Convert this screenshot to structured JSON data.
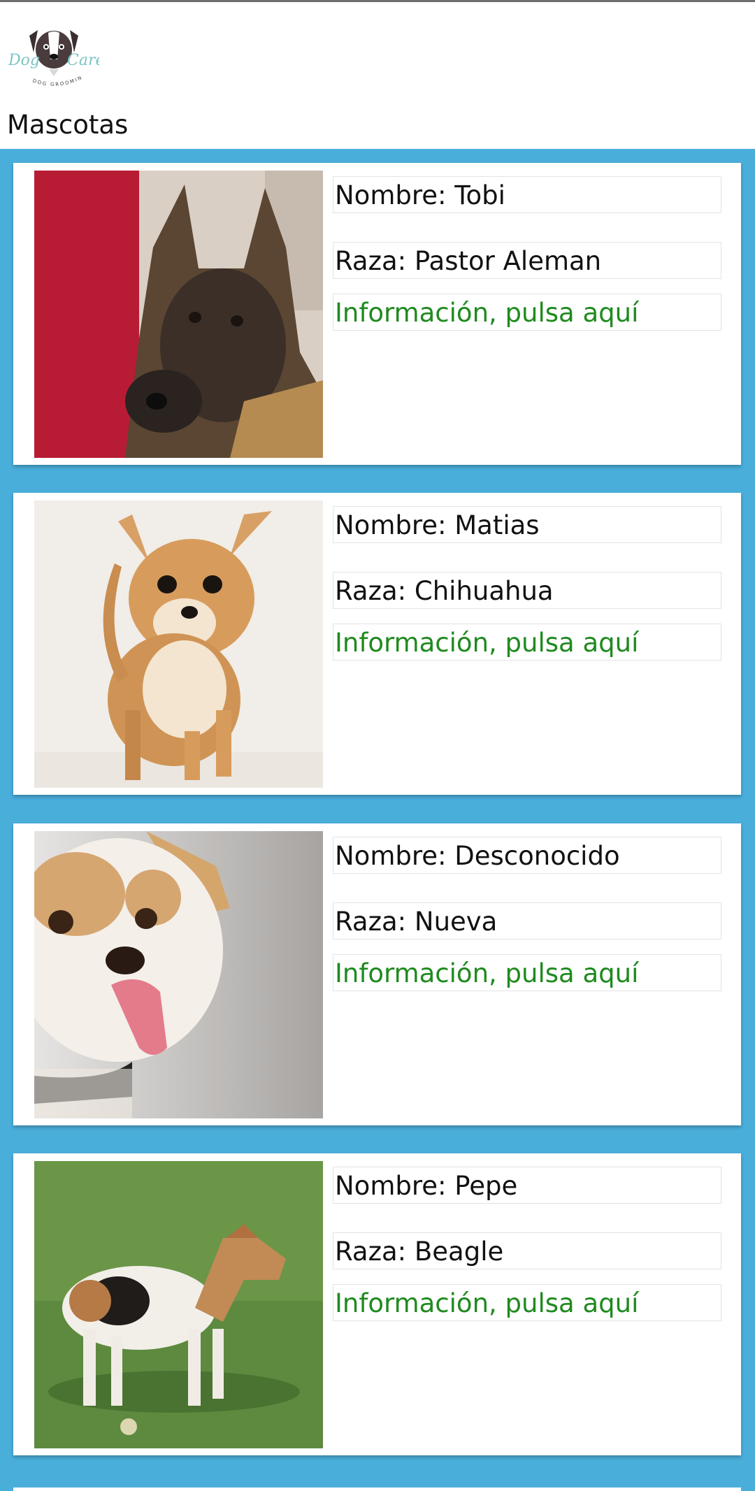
{
  "app": {
    "logo": {
      "text_top": "Dog",
      "text_bottom": "Care",
      "tagline": "DOG GROOMING",
      "icon": "dog-face-logo"
    },
    "title": "Mascotas"
  },
  "pets": [
    {
      "name": "Nombre: Tobi",
      "breed": "Raza: Pastor Aleman",
      "info": "Información, pulsa aquí"
    },
    {
      "name": "Nombre: Matias",
      "breed": "Raza: Chihuahua",
      "info": "Información, pulsa aquí"
    },
    {
      "name": "Nombre: Desconocido",
      "breed": "Raza: Nueva",
      "info": "Información, pulsa aquí"
    },
    {
      "name": "Nombre: Pepe",
      "breed": "Raza: Beagle",
      "info": "Información, pulsa aquí"
    }
  ],
  "colors": {
    "list_background": "#4aaedb",
    "card_background": "#ffffff",
    "info_text": "#1f8a1f"
  }
}
